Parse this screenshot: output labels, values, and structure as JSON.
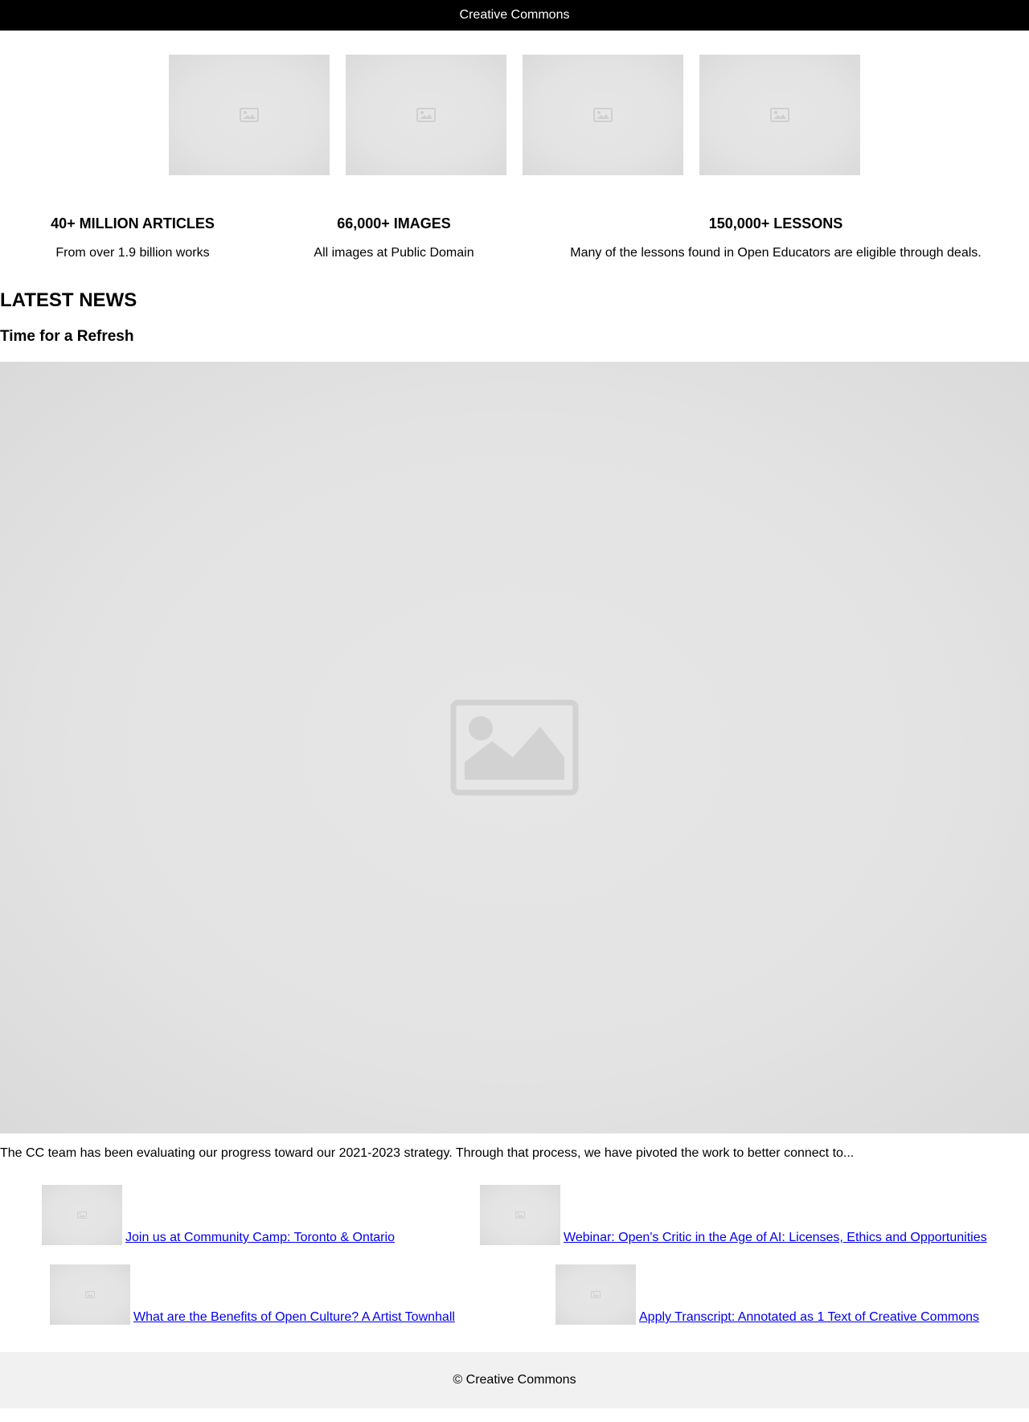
{
  "header": {
    "site_title": "Creative Commons"
  },
  "gallery": {
    "thumbnails": [
      {
        "icon": "image-placeholder-icon"
      },
      {
        "icon": "image-placeholder-icon"
      },
      {
        "icon": "image-placeholder-icon"
      },
      {
        "icon": "image-placeholder-icon"
      }
    ]
  },
  "stats": [
    {
      "title": "40+ MILLION ARTICLES",
      "text": "From over 1.9 billion works"
    },
    {
      "title": "66,000+ IMAGES",
      "text": "All images at Public Domain"
    },
    {
      "title": "150,000+ LESSONS",
      "text": "Many of the lessons found in Open Educators are eligible through deals."
    }
  ],
  "news": {
    "heading": "LATEST NEWS",
    "feature": {
      "title": "Time for a Refresh",
      "image_icon": "image-placeholder-icon",
      "excerpt": "The CC team has been evaluating our progress toward our 2021-2023 strategy. Through that process, we have pivoted the work to better connect to..."
    },
    "items": [
      {
        "label": "Join us at Community Camp: Toronto & Ontario"
      },
      {
        "label": "Webinar: Open's Critic in the Age of AI: Licenses, Ethics and Opportunities"
      },
      {
        "label": "What are the Benefits of Open Culture? A Artist Townhall"
      },
      {
        "label": "Apply Transcript: Annotated as 1 Text of Creative Commons"
      }
    ]
  },
  "footer": {
    "copyright": "© Creative Commons"
  },
  "colors": {
    "header_bg": "#000000",
    "link": "#0000ee",
    "footer_bg": "#f1f1f1",
    "placeholder": "#e3e3e3"
  }
}
